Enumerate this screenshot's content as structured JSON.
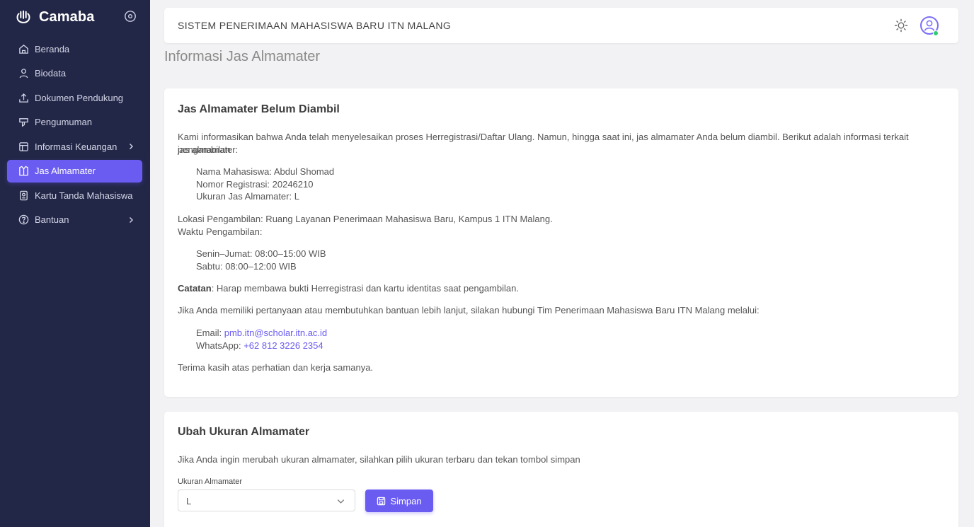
{
  "sidebar": {
    "brand": "Camaba",
    "items": [
      {
        "label": "Beranda",
        "icon": "home-icon",
        "active": false
      },
      {
        "label": "Biodata",
        "icon": "user-icon",
        "active": false
      },
      {
        "label": "Dokumen Pendukung",
        "icon": "upload-icon",
        "active": false
      },
      {
        "label": "Pengumuman",
        "icon": "megaphone-icon",
        "active": false
      },
      {
        "label": "Informasi Keuangan",
        "icon": "finance-icon",
        "active": false,
        "has_submenu": true
      },
      {
        "label": "Jas Almamater",
        "icon": "shirt-icon",
        "active": true
      },
      {
        "label": "Kartu Tanda Mahasiswa",
        "icon": "id-card-icon",
        "active": false
      },
      {
        "label": "Bantuan",
        "icon": "help-icon",
        "active": false,
        "has_submenu": true
      }
    ]
  },
  "header": {
    "title": "SISTEM PENERIMAAN MAHASISWA BARU ITN MALANG"
  },
  "page": {
    "title": "Informasi Jas Almamater"
  },
  "status_card": {
    "title": "Jas Almamater Belum Diambil",
    "intro_line1": "Kami informasikan bahwa Anda telah menyelesaikan proses Herregistrasi/Daftar Ulang. Namun, hingga saat ini, jas almamater Anda belum diambil. Berikut adalah informasi terkait pengambilan",
    "intro_line2": "jas almamater:",
    "details": [
      "Nama Mahasiswa: Abdul Shomad",
      "Nomor Registrasi: 20246210",
      "Ukuran Jas Almamater: L"
    ],
    "location": "Lokasi Pengambilan: Ruang Layanan Penerimaan Mahasiswa Baru, Kampus 1 ITN Malang.",
    "time_label": "Waktu Pengambilan:",
    "schedule": [
      "Senin–Jumat: 08:00–15:00 WIB",
      "Sabtu: 08:00–12:00 WIB"
    ],
    "note_label": "Catatan",
    "note_text": ": Harap membawa bukti Herregistrasi dan kartu identitas saat pengambilan.",
    "contact_intro": "Jika Anda memiliki pertanyaan atau membutuhkan bantuan lebih lanjut, silakan hubungi Tim Penerimaan Mahasiswa Baru ITN Malang melalui:",
    "email_label": "Email: ",
    "email": "pmb.itn@scholar.itn.ac.id",
    "whatsapp_label": "WhatsApp: ",
    "whatsapp": "+62 812 3226 2354",
    "closing": "Terima kasih atas perhatian dan kerja samanya."
  },
  "size_card": {
    "title": "Ubah Ukuran Almamater",
    "description": "Jika Anda ingin merubah ukuran almamater, silahkan pilih ukuran terbaru dan tekan tombol simpan",
    "field_label": "Ukuran Almamater",
    "selected_size": "L",
    "save_label": "Simpan"
  },
  "colors": {
    "sidebar_bg": "#232747",
    "accent": "#6a5cf0",
    "online": "#2ecc71"
  }
}
